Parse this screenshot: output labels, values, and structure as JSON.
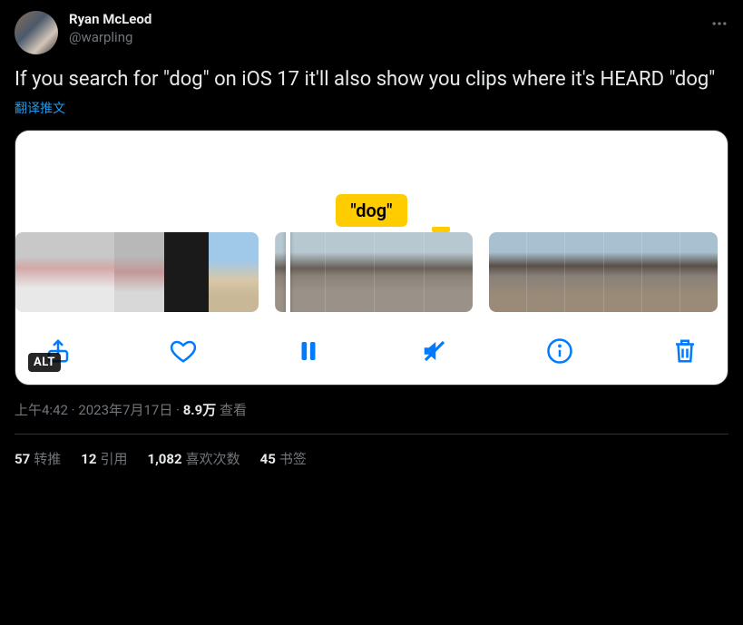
{
  "author": {
    "display_name": "Ryan McLeod",
    "handle": "@warpling"
  },
  "tweet_text": "If you search for \"dog\" on iOS 17 it'll also show you clips where it's HEARD \"dog\"",
  "translate_label": "翻译推文",
  "media": {
    "search_label": "\"dog\"",
    "alt_badge": "ALT"
  },
  "meta": {
    "time": "上午4:42",
    "date": "2023年7月17日",
    "views_number": "8.9万",
    "views_label": "查看",
    "separator": " · "
  },
  "stats": {
    "retweets": {
      "count": "57",
      "label": "转推"
    },
    "quotes": {
      "count": "12",
      "label": "引用"
    },
    "likes": {
      "count": "1,082",
      "label": "喜欢次数"
    },
    "bookmarks": {
      "count": "45",
      "label": "书签"
    }
  }
}
